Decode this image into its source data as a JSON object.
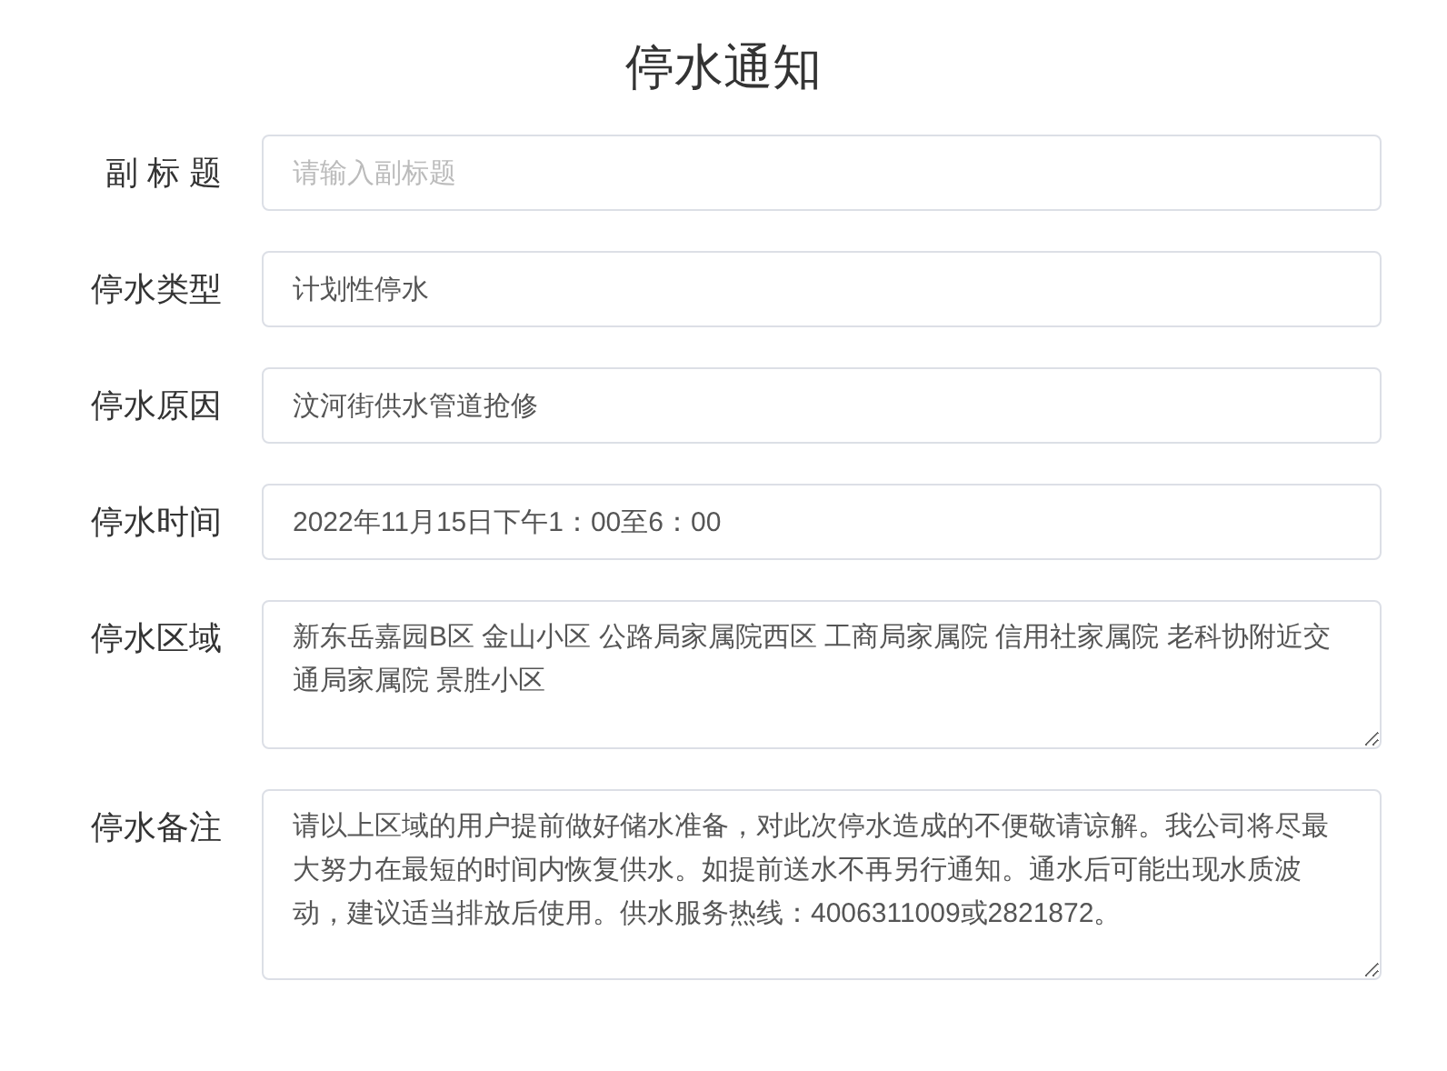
{
  "title": "停水通知",
  "fields": [
    {
      "label": "副 标 题",
      "kind": "input",
      "placeholder": "请输入副标题"
    },
    {
      "label": "停水类型",
      "kind": "input",
      "value": "计划性停水"
    },
    {
      "label": "停水原因",
      "kind": "input",
      "value": "汶河街供水管道抢修"
    },
    {
      "label": "停水时间",
      "kind": "input",
      "value": "2022年11月15日下午1：00至6：00"
    },
    {
      "label": "停水区域",
      "kind": "textarea",
      "value": "新东岳嘉园B区 金山小区 公路局家属院西区 工商局家属院 信用社家属院 老科协附近交通局家属院 景胜小区"
    },
    {
      "label": "停水备注",
      "kind": "textarea",
      "value": "请以上区域的用户提前做好储水准备，对此次停水造成的不便敬请谅解。我公司将尽最大努力在最短的时间内恢复供水。如提前送水不再另行通知。通水后可能出现水质波动，建议适当排放后使用。供水服务热线：4006311009或2821872。"
    }
  ]
}
